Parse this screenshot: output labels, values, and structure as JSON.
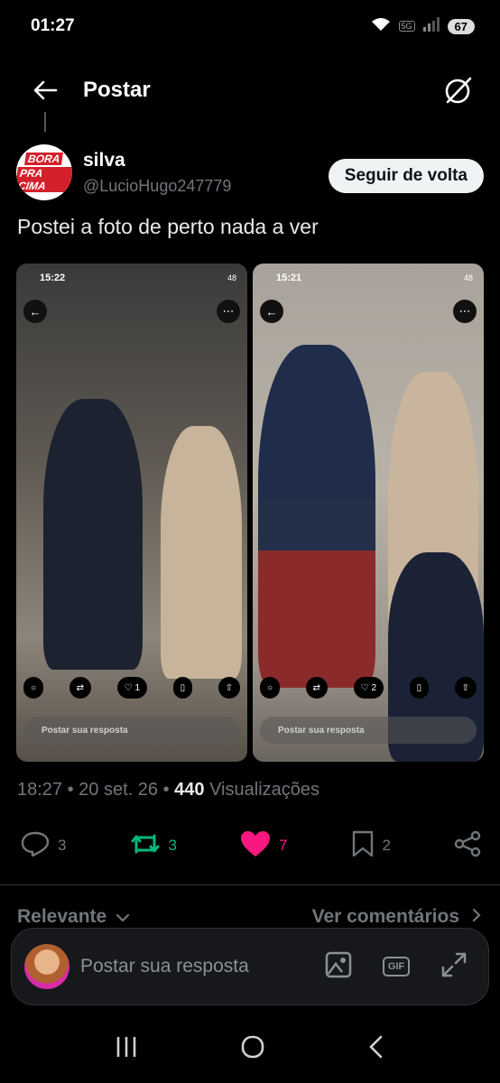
{
  "status_bar": {
    "time": "01:27",
    "network": "5G",
    "battery": "67"
  },
  "header": {
    "title": "Postar"
  },
  "post": {
    "author": {
      "name": "silva",
      "handle": "@LucioHugo247779",
      "avatar_text": [
        "BORA",
        "PRA CIMA"
      ]
    },
    "follow_label": "Seguir de volta",
    "text": "Postei a foto de perto nada a ver",
    "media": [
      {
        "time": "15:22",
        "battery": "48",
        "like_count": "1",
        "reply_placeholder": "Postar sua resposta"
      },
      {
        "time": "15:21",
        "battery": "48",
        "like_count": "2",
        "reply_placeholder": "Postar sua resposta"
      }
    ],
    "timestamp": "18:27 • 20 set. 26 •",
    "views_count": "440",
    "views_label": "Visualizações",
    "stats": {
      "replies": "3",
      "reposts": "3",
      "likes": "7",
      "bookmarks": "2"
    }
  },
  "sort": {
    "left_label": "Relevante",
    "right_label": "Ver comentários"
  },
  "composer": {
    "placeholder": "Postar sua resposta",
    "gif_label": "GIF"
  },
  "colors": {
    "background": "#000000",
    "repost_active": "#00ba7c",
    "like_active": "#f91880",
    "muted": "#71767b"
  }
}
